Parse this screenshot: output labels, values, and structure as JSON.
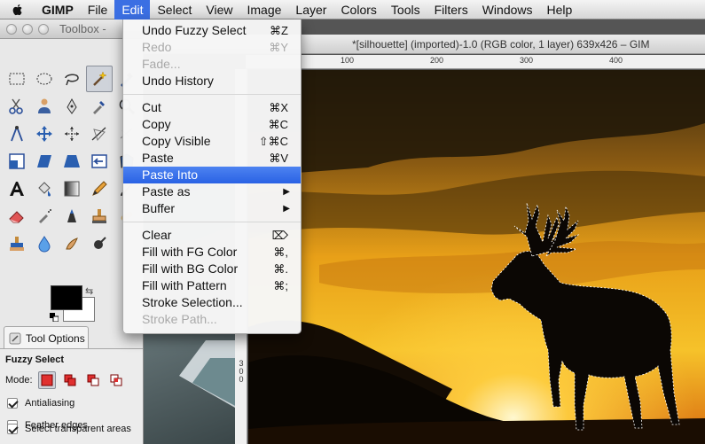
{
  "menubar": {
    "apple_icon": "apple-logo-icon",
    "app_name": "GIMP",
    "items": [
      "File",
      "Edit",
      "Select",
      "View",
      "Image",
      "Layer",
      "Colors",
      "Tools",
      "Filters",
      "Windows",
      "Help"
    ],
    "active": "Edit"
  },
  "toolbox": {
    "title": "Toolbox - ",
    "colors": {
      "foreground": "#000000",
      "background": "#ffffff"
    },
    "tool_options_tab": "Tool Options",
    "tool_options": {
      "heading": "Fuzzy Select",
      "mode_label": "Mode:",
      "antialiasing": {
        "label": "Antialiasing",
        "checked": true
      },
      "feather_edges": {
        "label": "Feather edges",
        "checked": false
      },
      "select_transparent": {
        "label": "Select transparent areas",
        "checked": true
      }
    }
  },
  "image_window": {
    "title": "*[silhouette] (imported)-1.0 (RGB color, 1 layer) 639x426 – GIM",
    "ruler_h": [
      "100",
      "200",
      "300",
      "400"
    ],
    "ruler_v": [
      "3",
      "0",
      "0"
    ]
  },
  "edit_menu": {
    "group1": [
      {
        "label": "Undo Fuzzy Select",
        "shortcut": "⌘Z",
        "disabled": false
      },
      {
        "label": "Redo",
        "shortcut": "⌘Y",
        "disabled": true
      },
      {
        "label": "Fade...",
        "shortcut": "",
        "disabled": true
      },
      {
        "label": "Undo History",
        "shortcut": "",
        "disabled": false
      }
    ],
    "group2": [
      {
        "label": "Cut",
        "shortcut": "⌘X"
      },
      {
        "label": "Copy",
        "shortcut": "⌘C"
      },
      {
        "label": "Copy Visible",
        "shortcut": "⇧⌘C"
      },
      {
        "label": "Paste",
        "shortcut": "⌘V"
      },
      {
        "label": "Paste Into",
        "shortcut": ""
      },
      {
        "label": "Paste as",
        "shortcut": "▶"
      },
      {
        "label": "Buffer",
        "shortcut": "▶"
      }
    ],
    "group3": [
      {
        "label": "Clear",
        "shortcut": "⌦"
      },
      {
        "label": "Fill with FG Color",
        "shortcut": "⌘,"
      },
      {
        "label": "Fill with BG Color",
        "shortcut": "⌘."
      },
      {
        "label": "Fill with Pattern",
        "shortcut": "⌘;"
      },
      {
        "label": "Stroke Selection...",
        "shortcut": ""
      },
      {
        "label": "Stroke Path...",
        "shortcut": ""
      }
    ],
    "highlighted": "Paste Into"
  }
}
